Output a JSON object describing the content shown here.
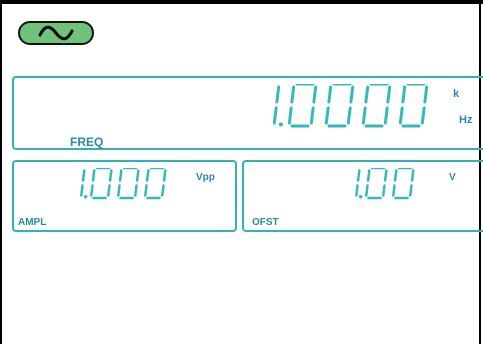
{
  "waveform": {
    "icon": "sine-wave-icon",
    "selected": true
  },
  "freq": {
    "value": "1.0000",
    "unit_prefix": "k",
    "unit": "Hz",
    "label": "FREQ"
  },
  "ampl": {
    "value": "1.000",
    "unit": "Vpp",
    "label": "AMPL"
  },
  "ofst": {
    "value": "1.00",
    "unit": "V",
    "label": "OFST"
  },
  "colors": {
    "digit": "#35b9bb",
    "label": "#2a8aa0",
    "border": "#2fb4b4",
    "button": "#6ec27a"
  }
}
